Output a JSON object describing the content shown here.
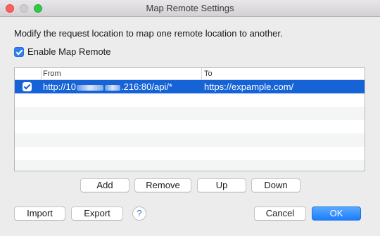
{
  "window": {
    "title": "Map Remote Settings"
  },
  "description": "Modify the request location to map one remote location to another.",
  "enable": {
    "label": "Enable Map Remote",
    "checked": true
  },
  "table": {
    "columns": [
      "From",
      "To"
    ],
    "rows": [
      {
        "checked": true,
        "from_prefix": "http://10",
        "from_suffix": ".216:80/api/*",
        "to": "https://expample.com/",
        "selected": true
      }
    ]
  },
  "buttons": {
    "add": "Add",
    "remove": "Remove",
    "up": "Up",
    "down": "Down",
    "import": "Import",
    "export": "Export",
    "help": "?",
    "cancel": "Cancel",
    "ok": "OK"
  },
  "colors": {
    "selection": "#1563d6",
    "accent": "#1a7efb"
  }
}
